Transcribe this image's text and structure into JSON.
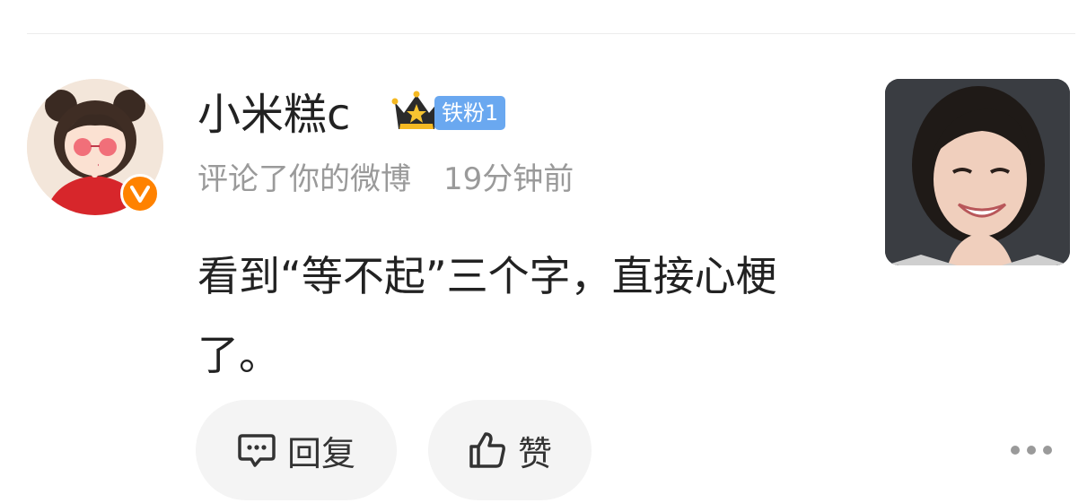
{
  "comment": {
    "username": "小米糕c",
    "fan_badge": "铁粉1",
    "action": "评论了你的微博",
    "time": "19分钟前",
    "text": "看到“等不起”三个字，直接心梗了。"
  },
  "actions": {
    "reply_label": "回复",
    "like_label": "赞"
  },
  "icons": {
    "verified": "verified-v-icon",
    "crown": "crown-icon",
    "reply": "comment-bubble-icon",
    "like": "thumbs-up-icon",
    "more": "more-dots-icon"
  },
  "colors": {
    "verified_orange": "#ff8200",
    "fan_badge_blue": "#6aa8f0",
    "meta_gray": "#9a9a9a",
    "pill_bg": "#f4f4f4"
  }
}
